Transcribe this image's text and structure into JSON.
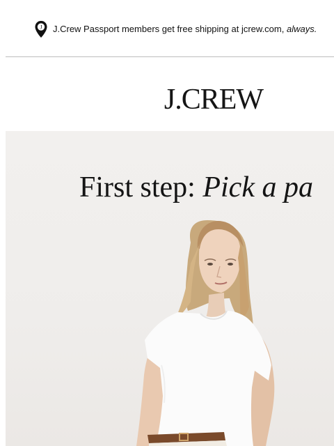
{
  "banner": {
    "icon": "location-pin-icon",
    "text": "J.Crew Passport members get free shipping at jcrew.com, ",
    "emphasis": "always."
  },
  "brand": {
    "logo_text": "J.CREW"
  },
  "hero": {
    "heading_prefix": "First step: ",
    "heading_italic": "Pick a pa",
    "image": "model-portrait"
  },
  "colors": {
    "hero_background": "#efedeb",
    "text": "#111111",
    "divider": "#bdbdbd"
  }
}
